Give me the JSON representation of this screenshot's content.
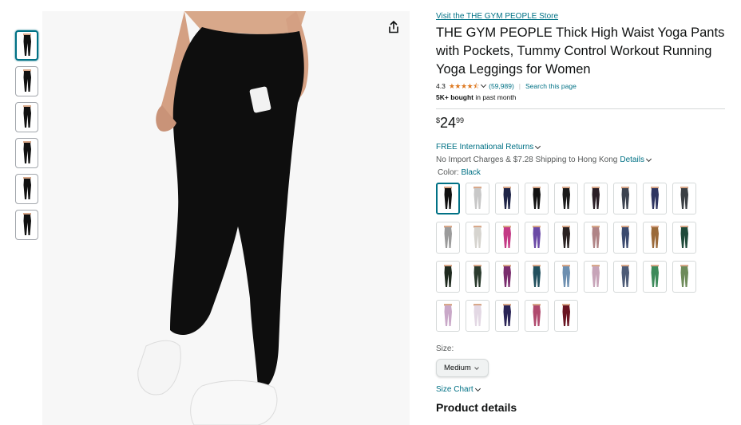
{
  "gallery": {
    "thumbnails": [
      {
        "color": "#111111",
        "style": "solid"
      },
      {
        "color": "#111111",
        "style": "solid"
      },
      {
        "color": "#111111",
        "style": "solid"
      },
      {
        "color": "#111111",
        "style": "solid"
      },
      {
        "color": "#111111",
        "style": "solid"
      },
      {
        "color": "#111111",
        "style": "solid"
      }
    ],
    "share_icon": "share-icon"
  },
  "product": {
    "store_link": "Visit the THE GYM PEOPLE Store",
    "title": "THE GYM PEOPLE Thick High Waist Yoga Pants with Pockets, Tummy Control Workout Running Yoga Leggings for Women",
    "rating": "4.3",
    "stars": "★★★★⯪",
    "rating_count": "(59,989)",
    "search_page": "Search this page",
    "bought_bold": "5K+ bought",
    "bought_rest": " in past month",
    "price": {
      "symbol": "$",
      "whole": "24",
      "fraction": "99"
    },
    "returns": "FREE International Returns",
    "shipping": "No Import Charges & $7.28 Shipping to Hong Kong",
    "shipping_details": "Details",
    "color_label": "Color: ",
    "color_value": "Black",
    "size_label": "Size:",
    "size_value": "Medium",
    "size_chart": "Size Chart",
    "product_details": "Product details"
  },
  "swatches": [
    {
      "color": "#111111"
    },
    {
      "color": "#c8c8c8"
    },
    {
      "color": "#1e2447"
    },
    {
      "color": "#121212"
    },
    {
      "color": "#1b1b1b"
    },
    {
      "color": "#2a1e26"
    },
    {
      "color": "#3c4350"
    },
    {
      "color": "#2e3560"
    },
    {
      "color": "#3a3f44"
    },
    {
      "color": "#9b9b9b"
    },
    {
      "color": "#d6d4cf"
    },
    {
      "color": "#c43a86"
    },
    {
      "color": "#6b4aa6"
    },
    {
      "color": "#2a2222"
    },
    {
      "color": "#b08486"
    },
    {
      "color": "#3b4a6e"
    },
    {
      "color": "#9a6a3a"
    },
    {
      "color": "#1f4a3a"
    },
    {
      "color": "#1f2a1f"
    },
    {
      "color": "#2b3b2e"
    },
    {
      "color": "#7a2d6e"
    },
    {
      "color": "#22505e"
    },
    {
      "color": "#6d8fb0"
    },
    {
      "color": "#c7a4b8"
    },
    {
      "color": "#4d5b76"
    },
    {
      "color": "#3c8a5a"
    },
    {
      "color": "#6e8b5a"
    },
    {
      "color": "#c9a8c8"
    },
    {
      "color": "#e3d8e4"
    },
    {
      "color": "#2a2456"
    },
    {
      "color": "#b04a6e"
    },
    {
      "color": "#6a1522"
    }
  ]
}
